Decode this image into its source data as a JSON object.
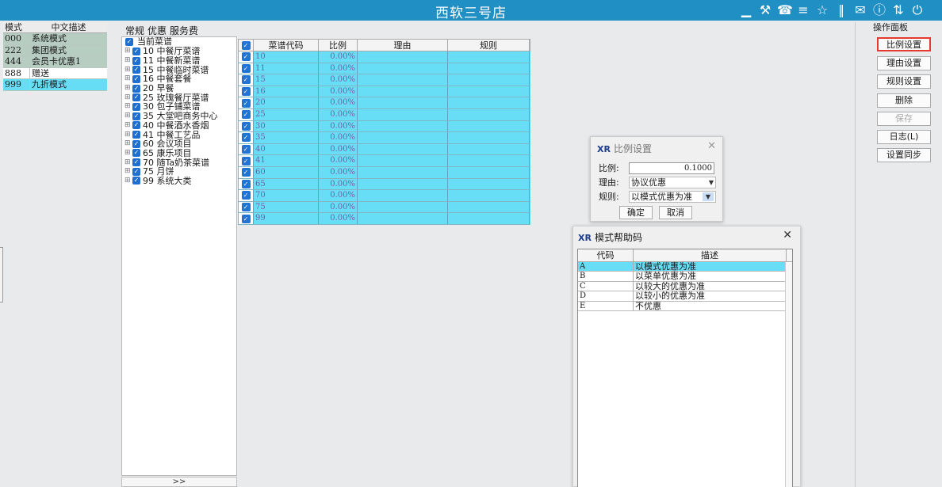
{
  "window": {
    "title": "西软三号店"
  },
  "topbar_icons": [
    "signal-icon",
    "tools-icon",
    "phone-icon",
    "menu-icon",
    "star-icon",
    "bars-icon",
    "mail-icon",
    "help-icon",
    "share-icon",
    "power-icon"
  ],
  "mode_table": {
    "headers": [
      "模式",
      "中文描述"
    ],
    "rows": [
      {
        "code": "000",
        "desc": "系统模式",
        "style": "green"
      },
      {
        "code": "222",
        "desc": "集团模式",
        "style": "green"
      },
      {
        "code": "444",
        "desc": "会员卡优惠1",
        "style": "green"
      },
      {
        "code": "888",
        "desc": "赠送",
        "style": "white"
      },
      {
        "code": "999",
        "desc": "九折模式",
        "style": "cyan"
      }
    ]
  },
  "tabs": [
    "常规",
    "优惠",
    "服务费"
  ],
  "tree": {
    "root": "当前菜谱",
    "items": [
      "10 中餐厅菜谱",
      "11 中餐新菜谱",
      "15 中餐临时菜谱",
      "16 中餐套餐",
      "20 早餐",
      "25 玫瑰餐厅菜谱",
      "30 包子铺菜谱",
      "35 大堂吧商务中心",
      "40 中餐酒水香烟",
      "41 中餐工艺品",
      "60 会议项目",
      "65 康乐项目",
      "70 随Ta奶茶菜谱",
      "75 月饼",
      "99 系统大类"
    ],
    "more": ">>"
  },
  "grid": {
    "headers": {
      "code": "菜谱代码",
      "rate": "比例",
      "reason": "理由",
      "rule": "规则"
    },
    "rows": [
      {
        "code": "10",
        "rate": "0.00%"
      },
      {
        "code": "11",
        "rate": "0.00%"
      },
      {
        "code": "15",
        "rate": "0.00%"
      },
      {
        "code": "16",
        "rate": "0.00%"
      },
      {
        "code": "20",
        "rate": "0.00%"
      },
      {
        "code": "25",
        "rate": "0.00%"
      },
      {
        "code": "30",
        "rate": "0.00%"
      },
      {
        "code": "35",
        "rate": "0.00%"
      },
      {
        "code": "40",
        "rate": "0.00%"
      },
      {
        "code": "41",
        "rate": "0.00%"
      },
      {
        "code": "60",
        "rate": "0.00%"
      },
      {
        "code": "65",
        "rate": "0.00%"
      },
      {
        "code": "70",
        "rate": "0.00%"
      },
      {
        "code": "75",
        "rate": "0.00%"
      },
      {
        "code": "99",
        "rate": "0.00%"
      }
    ]
  },
  "ratio_dialog": {
    "title": "比例设置",
    "rate_label": "比例:",
    "rate_value": "0.1000",
    "reason_label": "理由:",
    "reason_value": "协议优惠",
    "rule_label": "规则:",
    "rule_value": "以模式优惠为准",
    "ok": "确定",
    "cancel": "取消"
  },
  "help_dialog": {
    "title": "模式帮助码",
    "headers": {
      "code": "代码",
      "desc": "描述"
    },
    "rows": [
      {
        "code": "A",
        "desc": "以模式优惠为准"
      },
      {
        "code": "B",
        "desc": "以菜单优惠为准"
      },
      {
        "code": "C",
        "desc": "以较大的优惠为准"
      },
      {
        "code": "D",
        "desc": "以较小的优惠为准"
      },
      {
        "code": "E",
        "desc": "不优惠"
      }
    ]
  },
  "operation_panel": {
    "title": "操作面板",
    "buttons": [
      "比例设置",
      "理由设置",
      "规则设置",
      "删除",
      "保存",
      "日志(L)",
      "设置同步"
    ]
  }
}
